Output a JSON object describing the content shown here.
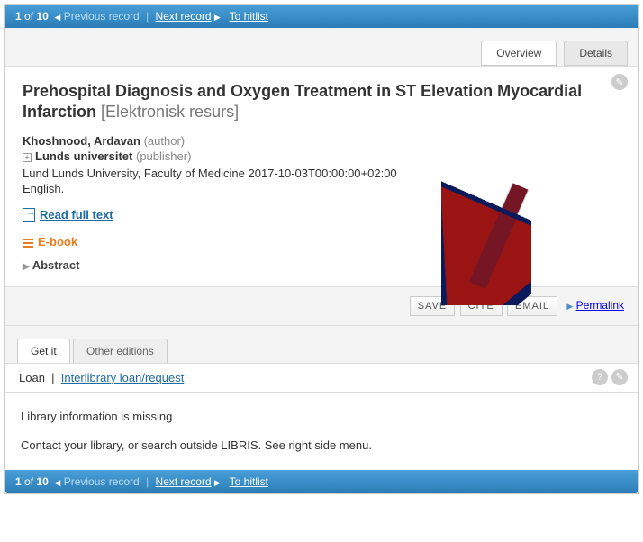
{
  "nav": {
    "pos_current": "1",
    "pos_of": "of",
    "pos_total": "10",
    "prev": "Previous record",
    "next": "Next record",
    "hitlist": "To hitlist"
  },
  "tabs_top": {
    "overview": "Overview",
    "details": "Details"
  },
  "record": {
    "title_main": "Prehospital Diagnosis and Oxygen Treatment in ST Elevation Myocardial Infarction",
    "title_sub": "[Elektronisk resurs]",
    "author_name": "Khoshnood, Ardavan",
    "author_role": "(author)",
    "publisher_name": "Lunds universitet",
    "publisher_role": "(publisher)",
    "imprint": "Lund Lunds University, Faculty of Medicine 2017-10-03T00:00:00+02:00",
    "language": "English.",
    "read_full": "Read full text",
    "ebook": "E-book",
    "abstract": "Abstract"
  },
  "actions": {
    "save": "SAVE",
    "cite": "CITE",
    "email": "EMAIL",
    "permalink": "Permalink"
  },
  "tabs_bottom": {
    "getit": "Get it",
    "other": "Other editions"
  },
  "loan": {
    "loan": "Loan",
    "ill": "Interlibrary loan/request"
  },
  "messages": {
    "missing": "Library information is missing",
    "contact": "Contact your library, or search outside LIBRIS. See right side menu."
  }
}
